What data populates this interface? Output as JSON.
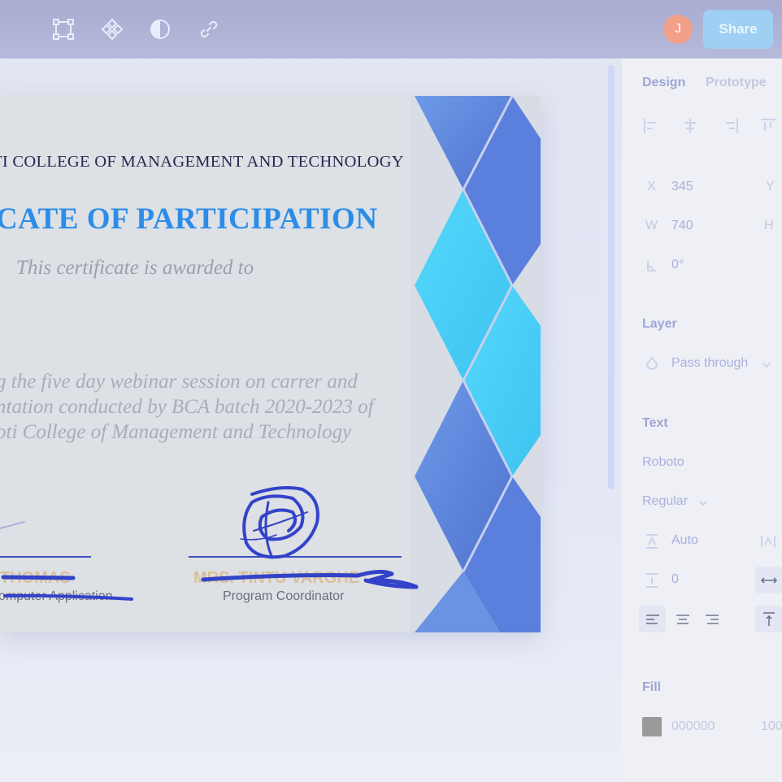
{
  "toolbar": {
    "tools": [
      {
        "icon": "frame-icon"
      },
      {
        "icon": "component-icon"
      },
      {
        "icon": "contrast-icon"
      },
      {
        "icon": "link-icon"
      }
    ],
    "avatar_initial": "J",
    "share_label": "Share"
  },
  "certificate": {
    "college_line": "TI COLLEGE OF MANAGEMENT AND TECHNOLOGY",
    "title": "ICATE OF PARTICIPATION",
    "awarded_to": "This certificate is awarded to",
    "body_lines": [
      "g the five day webinar session on carrer and",
      "ntation conducted by BCA batch 2020-2023 of",
      "oti College of Management and Technology"
    ],
    "signatories": [
      {
        "name": "THOMAS",
        "role": "omputer Application"
      },
      {
        "name": "MRS. TINTU VARGHE",
        "role": "Program Coordinator"
      }
    ]
  },
  "panel": {
    "tabs": {
      "design": "Design",
      "prototype": "Prototype"
    },
    "position": {
      "x_label": "X",
      "x_value": "345",
      "y_label": "Y",
      "w_label": "W",
      "w_value": "740",
      "h_label": "H",
      "rotation": "0°"
    },
    "layer": {
      "heading": "Layer",
      "blend_mode": "Pass through"
    },
    "text": {
      "heading": "Text",
      "font_family": "Roboto",
      "font_weight": "Regular",
      "line_height": "Auto",
      "letter_spacing": "0"
    },
    "fill": {
      "heading": "Fill",
      "hex": "000000",
      "opacity": "100"
    }
  }
}
